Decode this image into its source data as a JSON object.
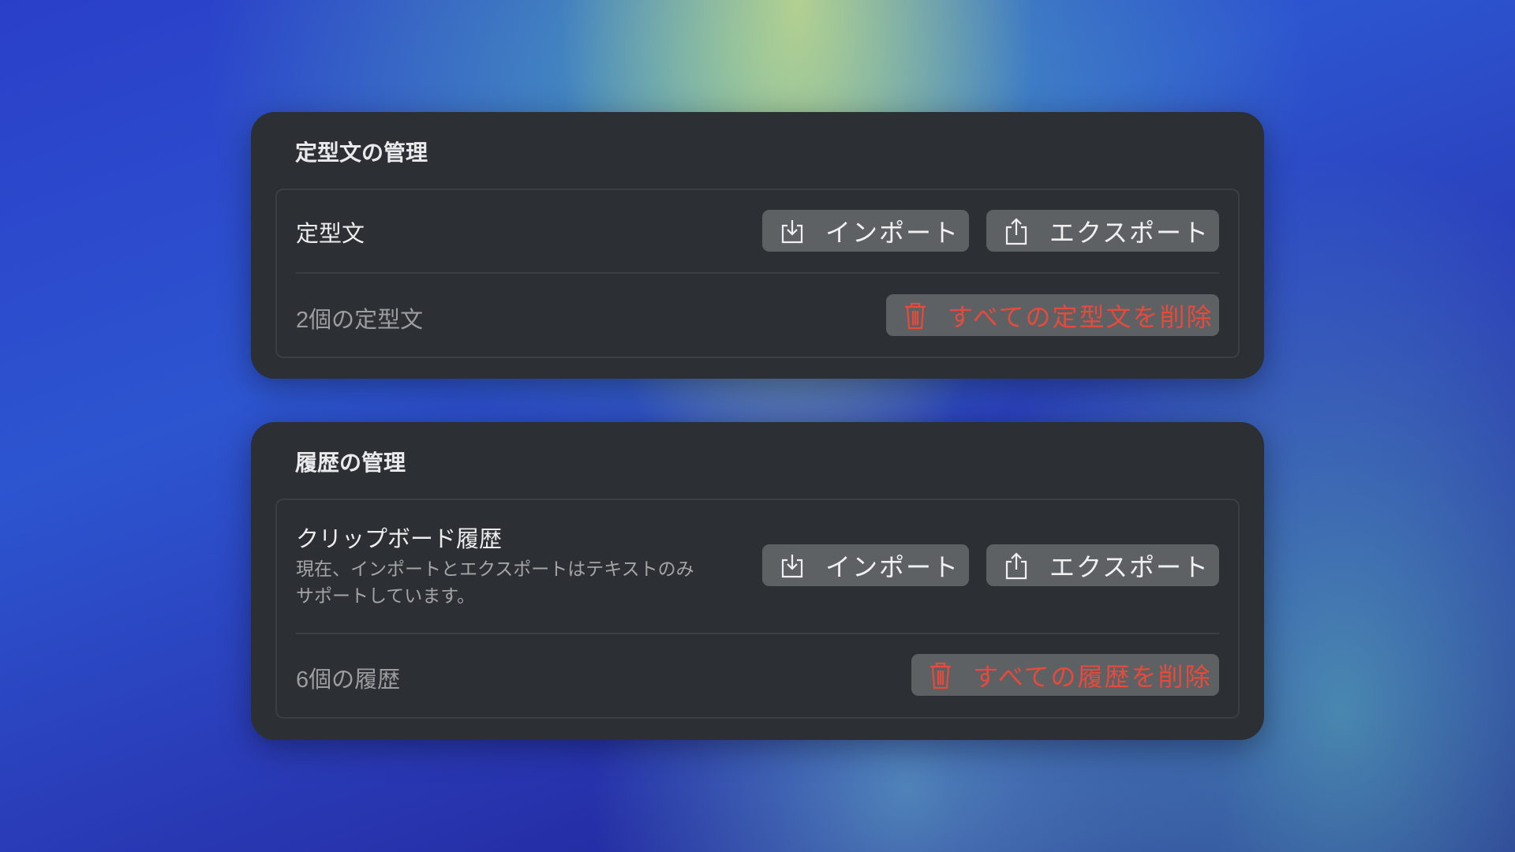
{
  "snippets_section": {
    "title": "定型文の管理",
    "row_label": "定型文",
    "import_label": "インポート",
    "export_label": "エクスポート",
    "count_label": "2個の定型文",
    "delete_all_label": "すべての定型文を削除"
  },
  "history_section": {
    "title": "履歴の管理",
    "row_label": "クリップボード履歴",
    "description_line1": "現在、インポートとエクスポートはテキストのみ",
    "description_line2": "サポートしています。",
    "import_label": "インポート",
    "export_label": "エクスポート",
    "count_label": "6個の履歴",
    "delete_all_label": "すべての履歴を削除"
  },
  "colors": {
    "card": "#2c2f33",
    "button": "#5e6164",
    "destructive": "#e64a3d"
  }
}
